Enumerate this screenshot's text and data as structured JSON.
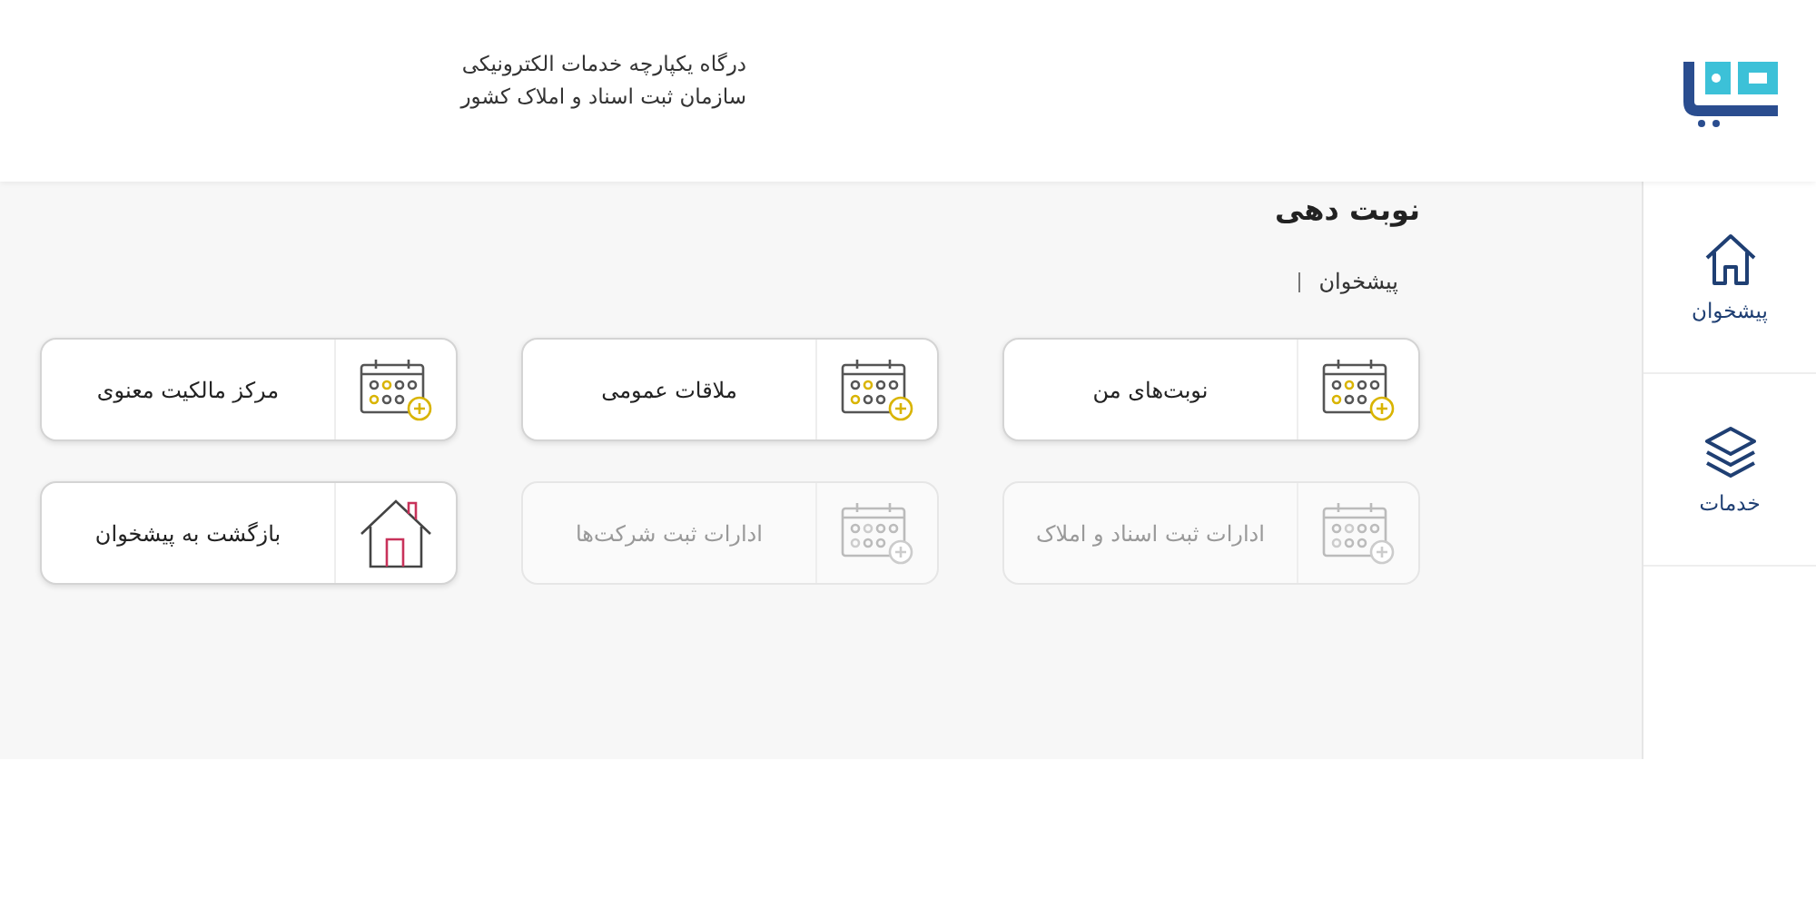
{
  "header": {
    "lines": [
      "درگاه یکپارچه خدمات الکترونیکی",
      "سازمان ثبت اسناد و املاک کشور"
    ]
  },
  "sidebar": {
    "items": [
      {
        "label": "پیشخوان",
        "kind": "home"
      },
      {
        "label": "خدمات",
        "kind": "layers"
      }
    ]
  },
  "page": {
    "title": "نوبت دهی",
    "breadcrumb": [
      "پیشخوان"
    ]
  },
  "cards": [
    {
      "label": "نوبت‌های من",
      "kind": "calendar",
      "disabled": false
    },
    {
      "label": "ملاقات عمومی",
      "kind": "calendar",
      "disabled": false
    },
    {
      "label": "مرکز مالکیت معنوی",
      "kind": "calendar",
      "disabled": false
    },
    {
      "label": "ادارات ثبت اسناد و املاک",
      "kind": "calendar",
      "disabled": true
    },
    {
      "label": "ادارات ثبت شرکت‌ها",
      "kind": "calendar",
      "disabled": true
    },
    {
      "label": "بازگشت به پیشخوان",
      "kind": "home",
      "disabled": false
    }
  ]
}
